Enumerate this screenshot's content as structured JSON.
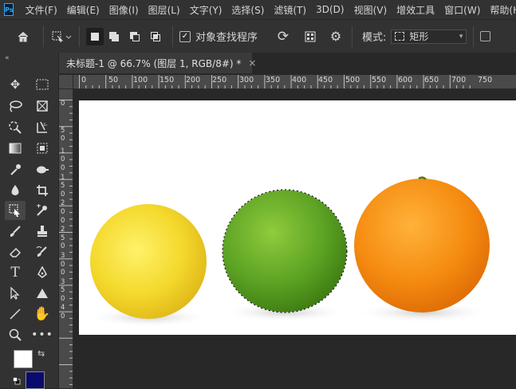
{
  "app": {
    "logo": "Ps"
  },
  "menu": [
    "文件(F)",
    "编辑(E)",
    "图像(I)",
    "图层(L)",
    "文字(Y)",
    "选择(S)",
    "滤镜(T)",
    "3D(D)",
    "视图(V)",
    "增效工具",
    "窗口(W)",
    "帮助(H)"
  ],
  "options": {
    "object_finder_label": "对象查找程序",
    "object_finder_checked": true,
    "mode_label": "模式:",
    "mode_value": "矩形"
  },
  "toolbar": {
    "collapse": "«",
    "foreground_color": "#ffffff",
    "background_color": "#0b0b6e"
  },
  "document": {
    "tab_title": "未标题-1 @ 66.7% (图层 1, RGB/8#) *",
    "close": "×",
    "background": "#ffffff"
  },
  "ruler": {
    "horizontal": [
      "0",
      "50",
      "100",
      "150",
      "200",
      "250",
      "300",
      "350",
      "400",
      "450",
      "500",
      "550",
      "600",
      "650",
      "700",
      "750"
    ],
    "vertical": [
      "0",
      "5",
      "0",
      "1",
      "0",
      "0",
      "1",
      "5",
      "0",
      "2",
      "0",
      "0",
      "2",
      "5",
      "0",
      "3",
      "0",
      "0",
      "3",
      "5",
      "0",
      "4",
      "0"
    ]
  },
  "fruits": [
    {
      "name": "lemon",
      "color": "#f3d52a"
    },
    {
      "name": "lime",
      "color": "#5ca223",
      "selected": true
    },
    {
      "name": "orange",
      "color": "#f58b10"
    }
  ]
}
